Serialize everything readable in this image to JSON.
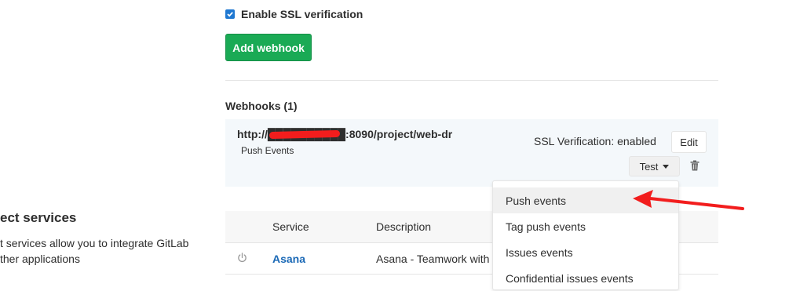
{
  "form": {
    "ssl_checkbox_checked": true,
    "ssl_label": "Enable SSL verification",
    "add_button": "Add webhook"
  },
  "webhooks": {
    "title": "Webhooks (1)",
    "items": [
      {
        "url": "http://██████████:8090/project/web-dr",
        "events": "Push Events",
        "ssl_status": "SSL Verification: enabled",
        "edit_label": "Edit",
        "test_label": "Test"
      }
    ]
  },
  "services": {
    "title": "ect services",
    "description": "t services allow you to integrate GitLab ther applications",
    "columns": [
      "Service",
      "Description"
    ],
    "rows": [
      {
        "name": "Asana",
        "description": "Asana - Teamwork with"
      }
    ]
  },
  "test_dropdown": {
    "items": [
      {
        "label": "Push events",
        "active": true
      },
      {
        "label": "Tag push events",
        "active": false
      },
      {
        "label": "Issues events",
        "active": false
      },
      {
        "label": "Confidential issues events",
        "active": false
      }
    ]
  },
  "colors": {
    "primary_blue": "#1f78d1",
    "success_green": "#1aaa55",
    "annotation_red": "#f21d1d",
    "link_blue": "#1b69b6"
  }
}
